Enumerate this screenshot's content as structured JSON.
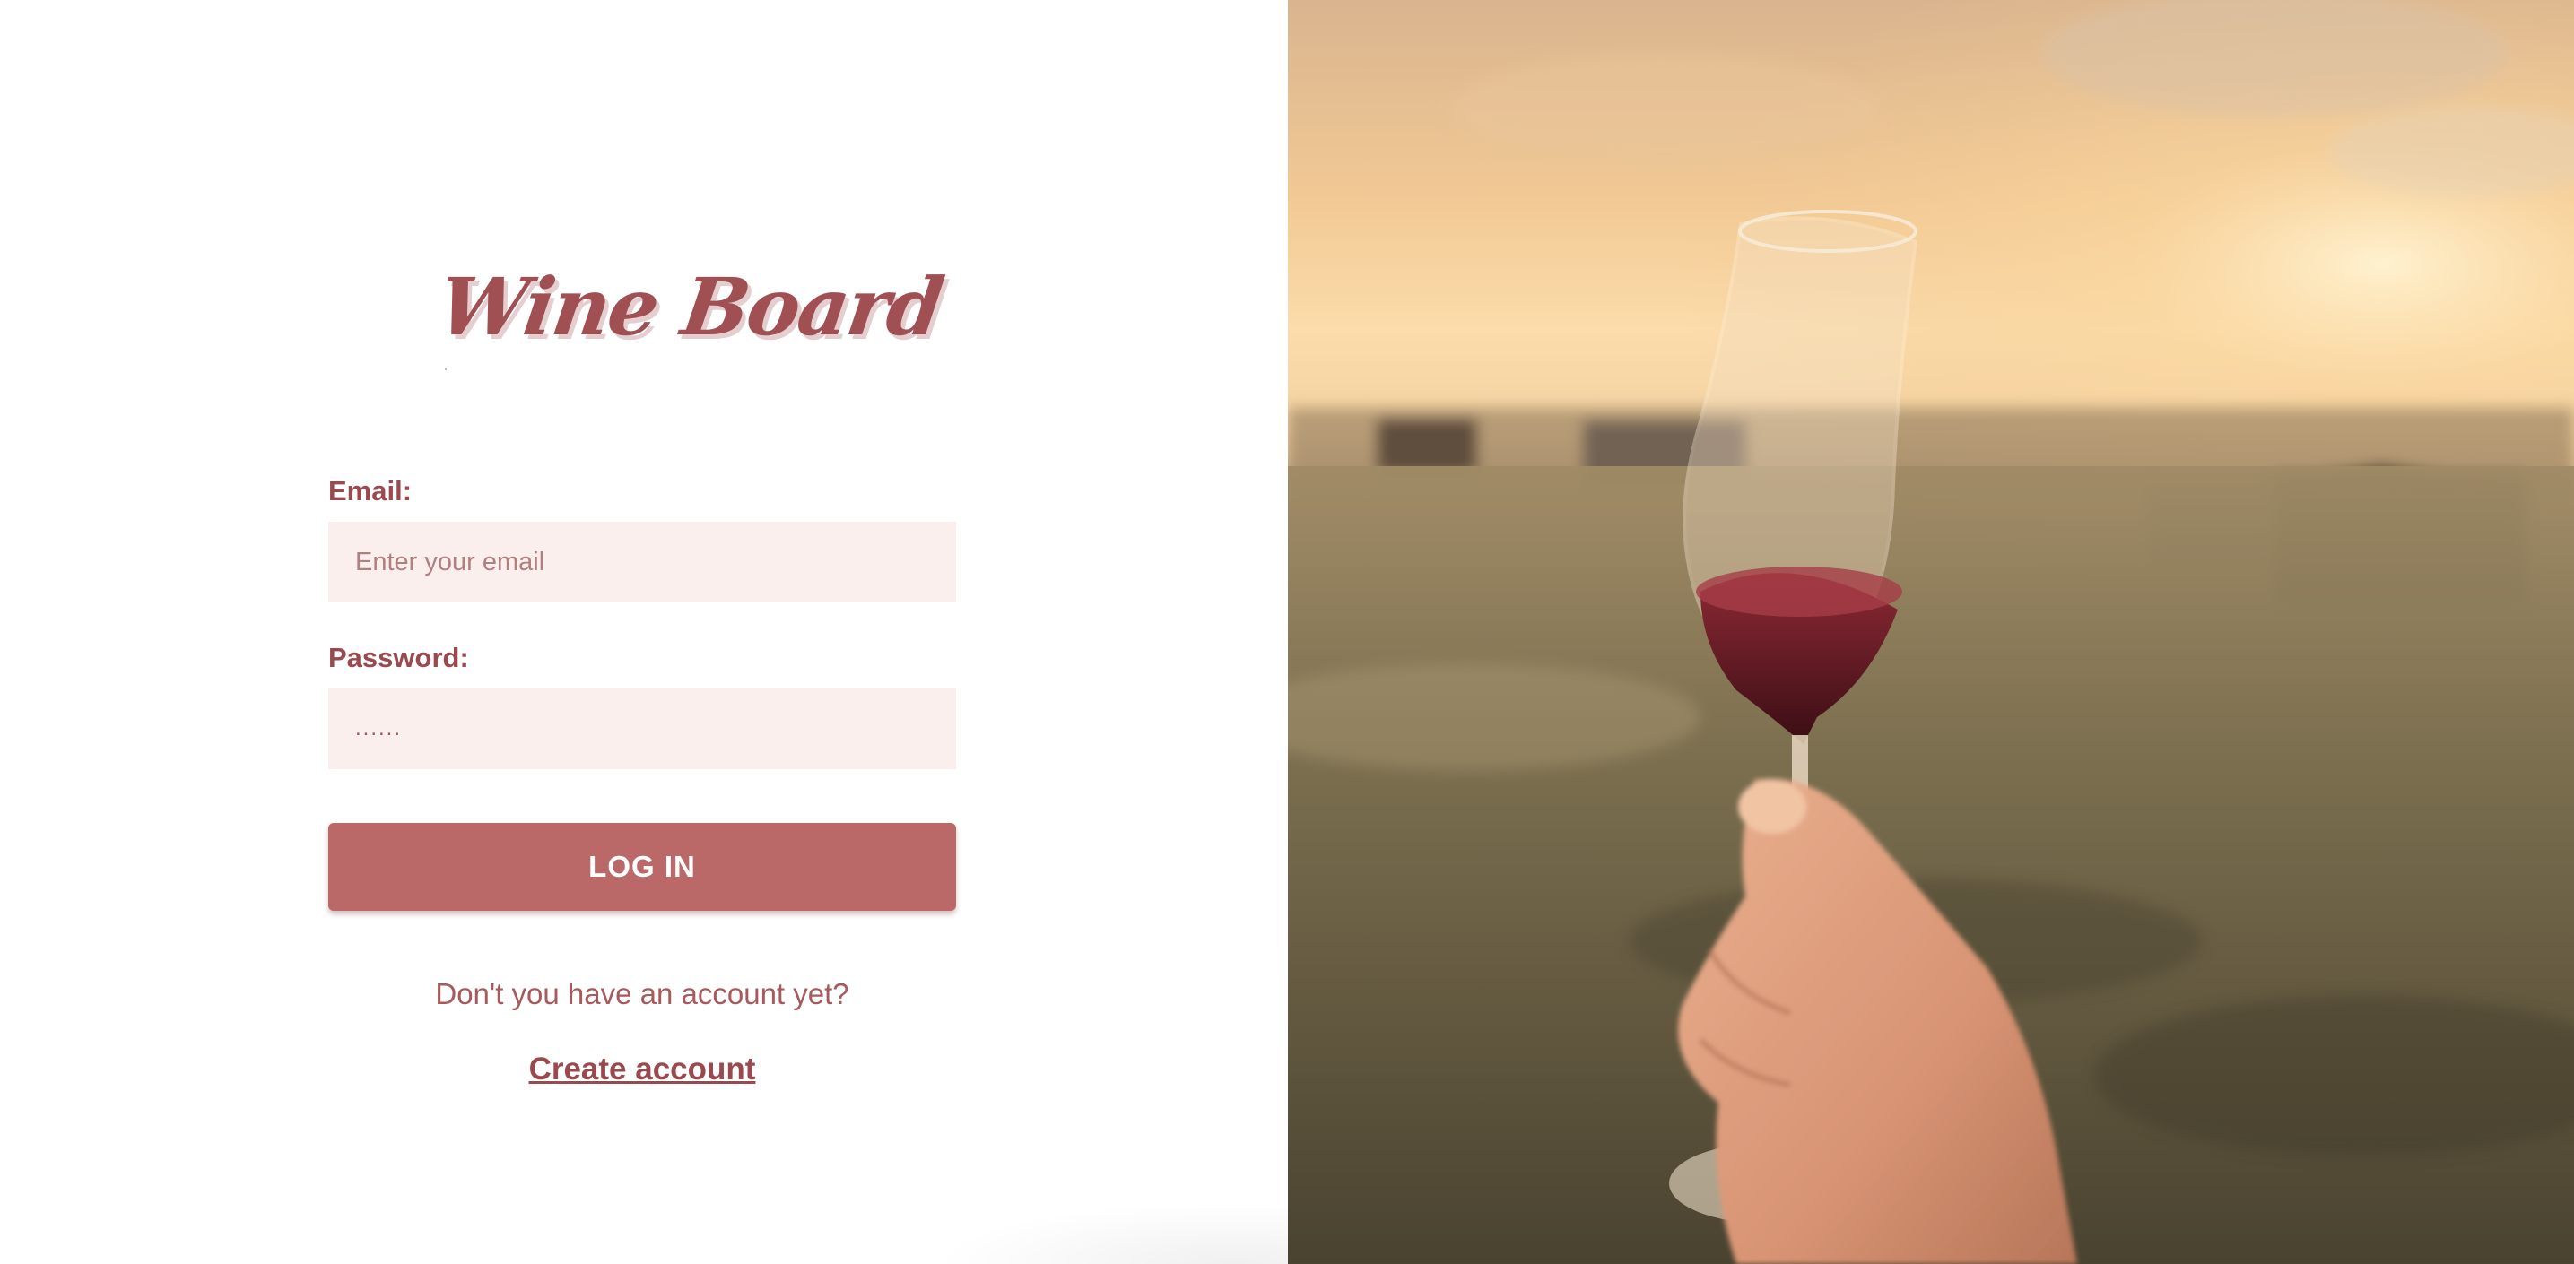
{
  "app": {
    "logo_text": "Wine Board"
  },
  "login_form": {
    "email_label": "Email:",
    "email_placeholder": "Enter your email",
    "password_label": "Password:",
    "password_value": "......",
    "login_button_label": "LOG IN"
  },
  "signup": {
    "prompt": "Don't you have an account yet?",
    "link_label": "Create account"
  },
  "photo": {
    "subject": "hand-holding-wine-glass-photo"
  },
  "colors": {
    "brand": "#a04f53",
    "button": "#bb6869",
    "input_background": "#fbefee"
  }
}
